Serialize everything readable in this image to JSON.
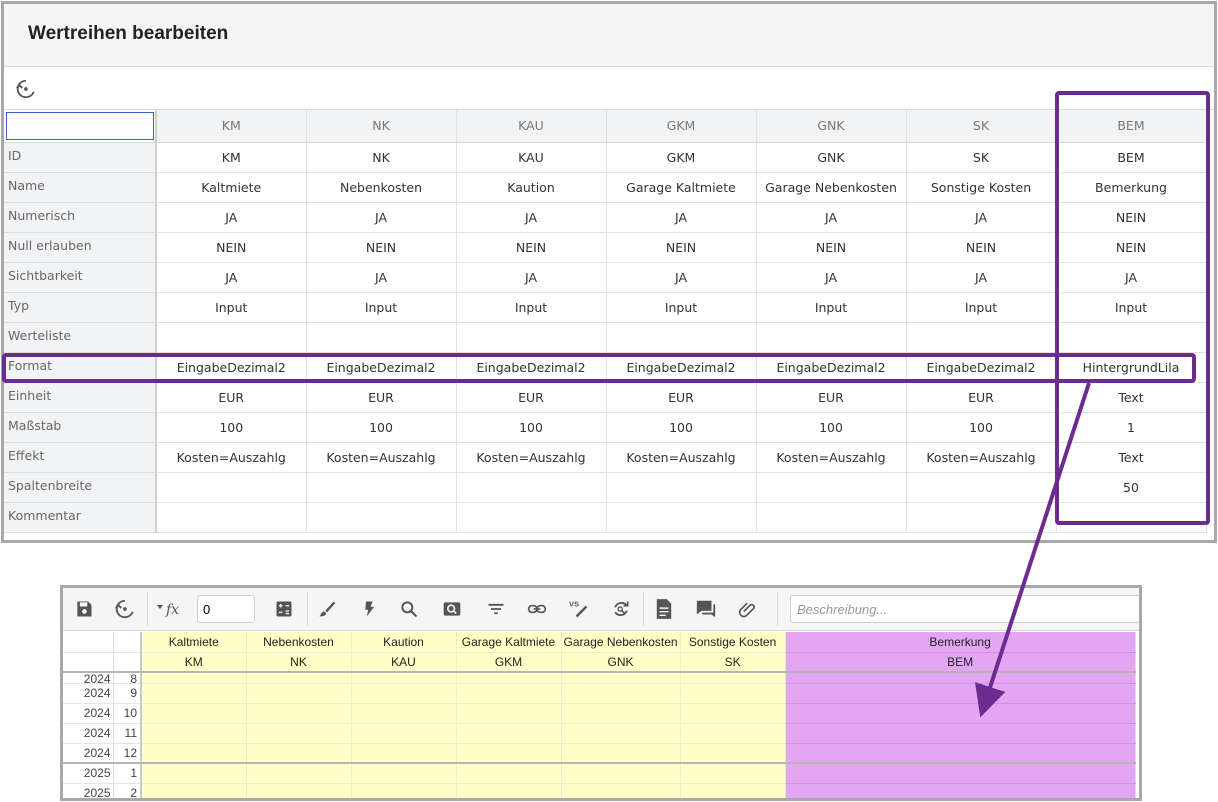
{
  "dialog": {
    "title": "Wertreihen bearbeiten",
    "corner_value": ""
  },
  "table": {
    "columns": [
      "KM",
      "NK",
      "KAU",
      "GKM",
      "GNK",
      "SK",
      "BEM"
    ],
    "rows": [
      {
        "label": "ID",
        "values": [
          "KM",
          "NK",
          "KAU",
          "GKM",
          "GNK",
          "SK",
          "BEM"
        ]
      },
      {
        "label": "Name",
        "values": [
          "Kaltmiete",
          "Nebenkosten",
          "Kaution",
          "Garage Kaltmiete",
          "Garage Nebenkosten",
          "Sonstige Kosten",
          "Bemerkung"
        ]
      },
      {
        "label": "Numerisch",
        "values": [
          "JA",
          "JA",
          "JA",
          "JA",
          "JA",
          "JA",
          "NEIN"
        ]
      },
      {
        "label": "Null erlauben",
        "values": [
          "NEIN",
          "NEIN",
          "NEIN",
          "NEIN",
          "NEIN",
          "NEIN",
          "NEIN"
        ]
      },
      {
        "label": "Sichtbarkeit",
        "values": [
          "JA",
          "JA",
          "JA",
          "JA",
          "JA",
          "JA",
          "JA"
        ]
      },
      {
        "label": "Typ",
        "values": [
          "Input",
          "Input",
          "Input",
          "Input",
          "Input",
          "Input",
          "Input"
        ]
      },
      {
        "label": "Werteliste",
        "values": [
          "",
          "",
          "",
          "",
          "",
          "",
          ""
        ]
      },
      {
        "label": "Format",
        "values": [
          "EingabeDezimal2",
          "EingabeDezimal2",
          "EingabeDezimal2",
          "EingabeDezimal2",
          "EingabeDezimal2",
          "EingabeDezimal2",
          "HintergrundLila"
        ]
      },
      {
        "label": "Einheit",
        "values": [
          "EUR",
          "EUR",
          "EUR",
          "EUR",
          "EUR",
          "EUR",
          "Text"
        ]
      },
      {
        "label": "Maßstab",
        "values": [
          "100",
          "100",
          "100",
          "100",
          "100",
          "100",
          "1"
        ]
      },
      {
        "label": "Effekt",
        "values": [
          "Kosten=Auszahlg",
          "Kosten=Auszahlg",
          "Kosten=Auszahlg",
          "Kosten=Auszahlg",
          "Kosten=Auszahlg",
          "Kosten=Auszahlg",
          "Text"
        ]
      },
      {
        "label": "Spaltenbreite",
        "values": [
          "",
          "",
          "",
          "",
          "",
          "",
          "50"
        ]
      },
      {
        "label": "Kommentar",
        "values": [
          "",
          "",
          "",
          "",
          "",
          "",
          ""
        ]
      }
    ]
  },
  "grid": {
    "toolbar": {
      "value": "0",
      "description_placeholder": "Beschreibung...",
      "icons": [
        "save-icon",
        "reset-icon",
        "formula-icon",
        "calculator-icon",
        "brush-icon",
        "flash-icon",
        "search-icon",
        "find-icon",
        "filter-icon",
        "link-icon",
        "compare-icon",
        "refresh-icon",
        "document-icon",
        "comment-icon",
        "attachment-icon"
      ]
    },
    "columns": [
      {
        "name": "Kaltmiete",
        "id": "KM"
      },
      {
        "name": "Nebenkosten",
        "id": "NK"
      },
      {
        "name": "Kaution",
        "id": "KAU"
      },
      {
        "name": "Garage Kaltmiete",
        "id": "GKM"
      },
      {
        "name": "Garage Nebenkosten",
        "id": "GNK"
      },
      {
        "name": "Sonstige Kosten",
        "id": "SK"
      },
      {
        "name": "Bemerkung",
        "id": "BEM"
      }
    ],
    "rows": [
      {
        "year": "2024",
        "month": "8"
      },
      {
        "year": "2024",
        "month": "9"
      },
      {
        "year": "2024",
        "month": "10"
      },
      {
        "year": "2024",
        "month": "11"
      },
      {
        "year": "2024",
        "month": "12"
      },
      {
        "year": "2025",
        "month": "1"
      },
      {
        "year": "2025",
        "month": "2"
      }
    ],
    "colors": {
      "numeric_cell": "#ffffc8",
      "purple_cell": "#e3a6f2",
      "highlight": "#6a2d8f"
    }
  }
}
